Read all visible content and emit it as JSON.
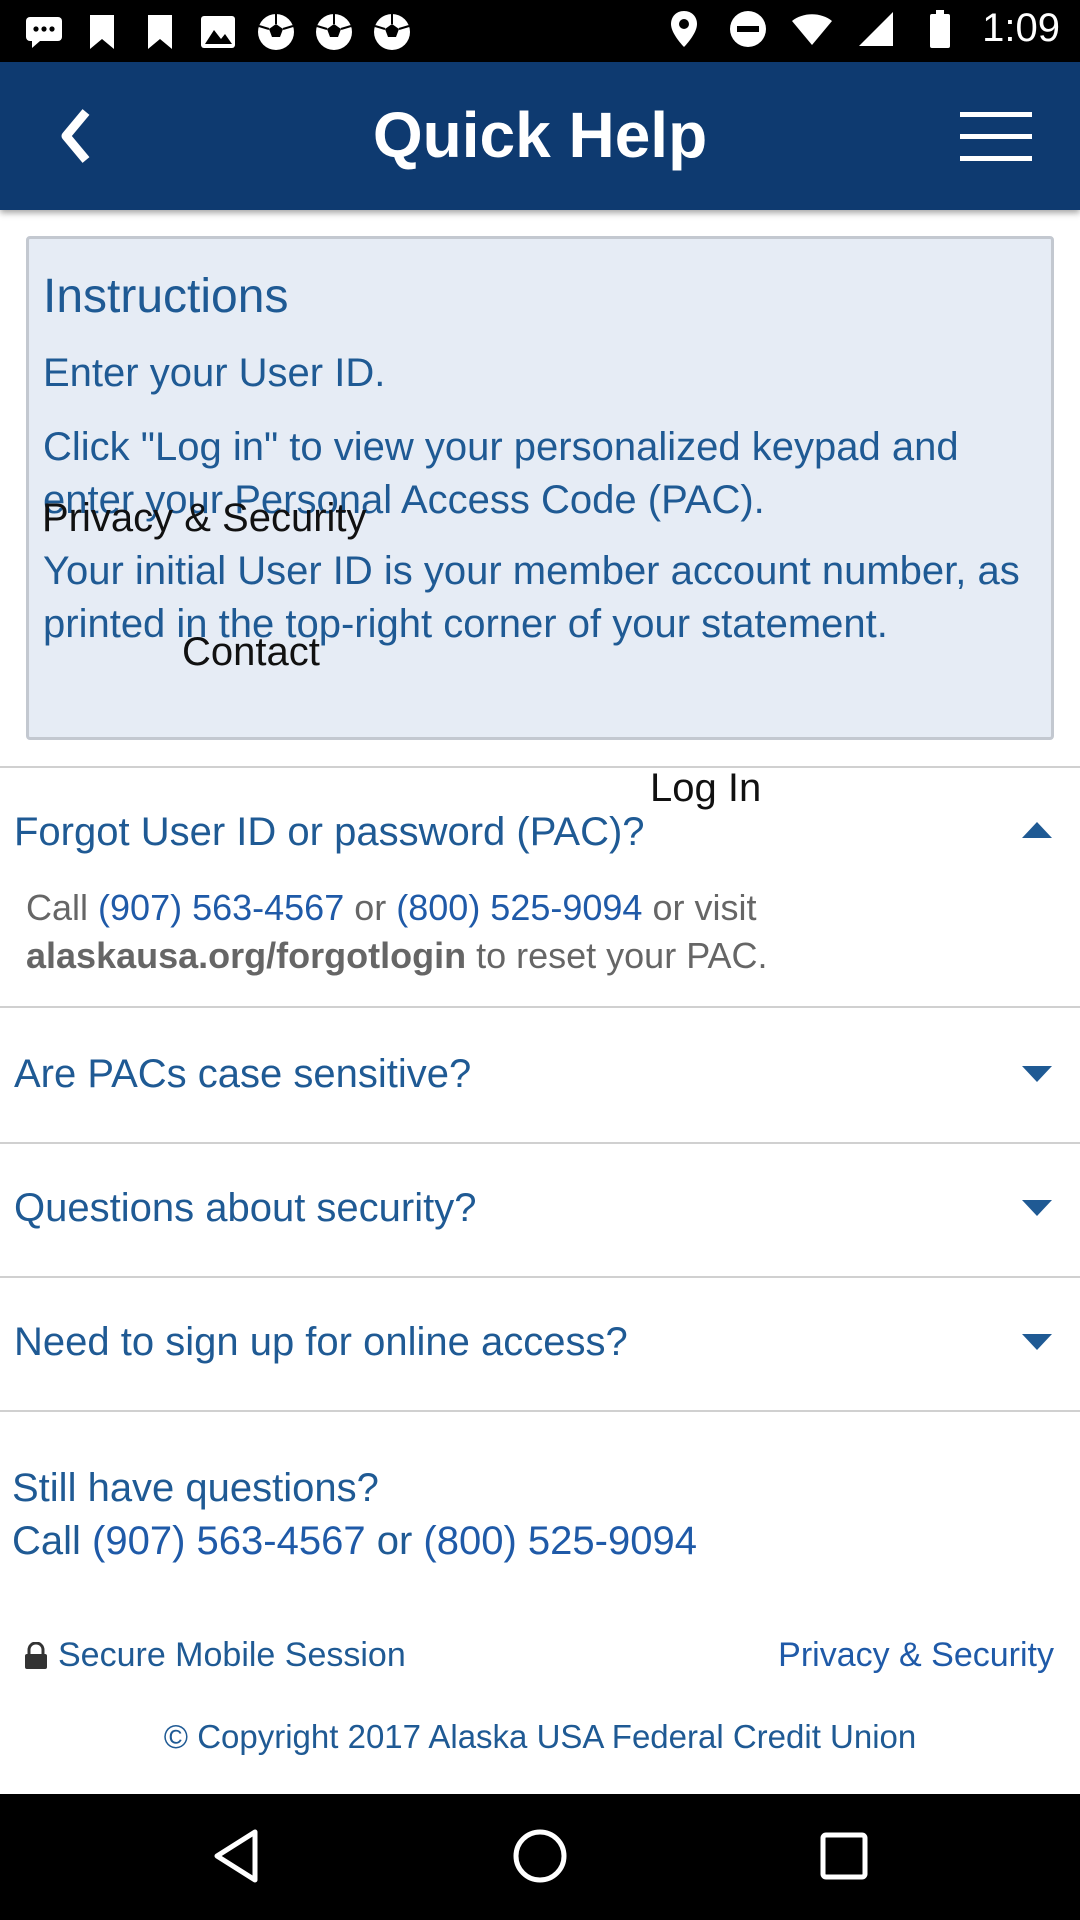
{
  "status_bar": {
    "time": "1:09",
    "left_icons": [
      "message-icon",
      "bookmark-icon",
      "bookmark-icon",
      "image-icon",
      "soccer-icon",
      "soccer-icon",
      "soccer-icon"
    ],
    "right_icons": [
      "location-icon",
      "do-not-disturb-icon",
      "wifi-icon",
      "signal-icon",
      "battery-icon"
    ]
  },
  "header": {
    "title": "Quick Help"
  },
  "instructions": {
    "title": "Instructions",
    "p1": "Enter your User ID.",
    "p2": "Click \"Log in\" to view your personalized keypad and enter your Personal Access Code (PAC).",
    "p3": "Your initial User ID is your member account number, as printed in the top-right corner of your statement."
  },
  "overlays": {
    "privacy": "Privacy & Security",
    "contact": "Contact",
    "login": "Log In"
  },
  "faq": {
    "q1": "Forgot User ID or password (PAC)?",
    "a1_call": "Call",
    "a1_phone1": "(907) 563-4567",
    "a1_or": "or",
    "a1_phone2": "(800) 525-9094",
    "a1_visit": "or visit",
    "a1_link": "alaskausa.org/forgotlogin",
    "a1_tail": "to reset your PAC.",
    "q2": "Are PACs case sensitive?",
    "q3": "Questions about security?",
    "q4": "Need to sign up for online access?"
  },
  "footer": {
    "still_line": "Still have questions?",
    "call_prefix": "Call",
    "phone1": "(907) 563-4567",
    "or": "or",
    "phone2": "(800) 525-9094",
    "secure_label": "Secure Mobile Session",
    "privacy_link": "Privacy & Security",
    "copyright": "© Copyright 2017 Alaska USA Federal Credit Union"
  },
  "colors": {
    "header_bg": "#0e3a70",
    "text_blue": "#1f5a94",
    "link_blue": "#1f5aa8",
    "card_bg": "#e6ecf5"
  }
}
